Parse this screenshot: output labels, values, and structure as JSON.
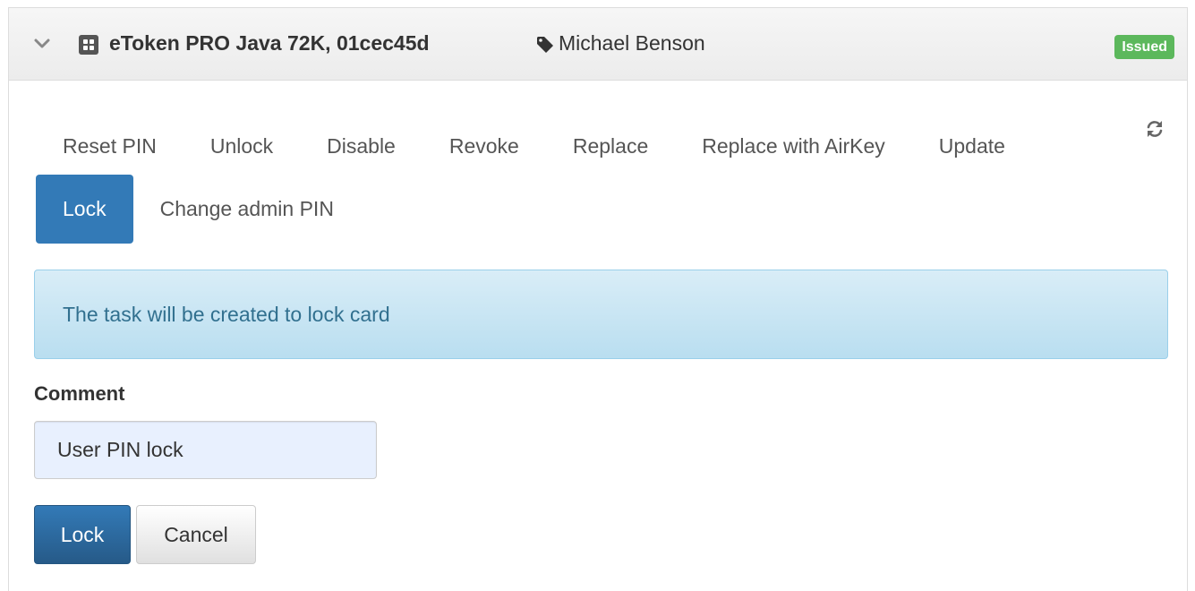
{
  "panel": {
    "token_title": "eToken PRO Java 72K, 01cec45d",
    "owner_name": "Michael Benson",
    "status_badge": "Issued",
    "icons": {
      "expand": "chevron-down-icon",
      "token": "smartcard-icon",
      "owner": "tag-icon",
      "refresh": "refresh-icon"
    }
  },
  "actions": {
    "row1": [
      "Reset PIN",
      "Unlock",
      "Disable",
      "Revoke",
      "Replace",
      "Replace with AirKey",
      "Update"
    ],
    "row2": [
      "Lock",
      "Change admin PIN"
    ],
    "active": "Lock"
  },
  "info_message": "The task will be created to lock card",
  "form": {
    "comment_label": "Comment",
    "comment_value": "User PIN lock",
    "submit_label": "Lock",
    "cancel_label": "Cancel"
  },
  "colors": {
    "primary": "#337ab7",
    "success": "#5cb85c",
    "info_text": "#31708f",
    "info_bg": "#d9edf7"
  }
}
